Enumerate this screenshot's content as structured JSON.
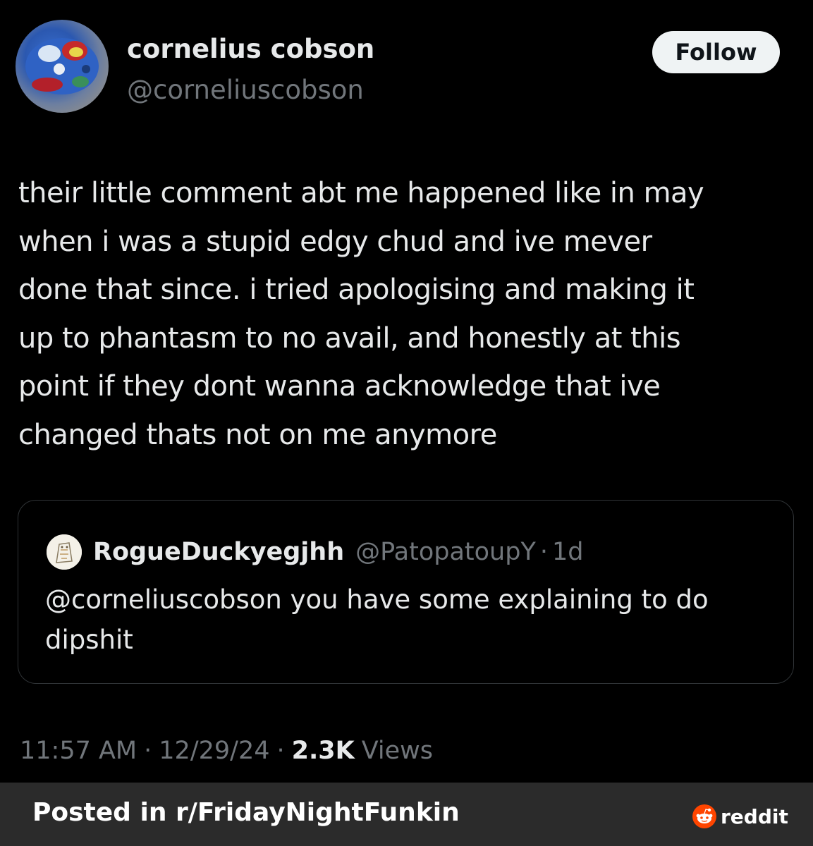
{
  "tweet": {
    "display_name": "cornelius cobson",
    "handle": "@corneliuscobson",
    "follow_label": "Follow",
    "body_lines": [
      "their little comment abt me happened like in may",
      "when i was a stupid edgy chud and ive mever",
      "done that since. i tried apologising and making it",
      "up to phantasm to no avail, and honestly at this",
      "point if they dont wanna acknowledge that ive",
      "changed thats not on me anymore"
    ],
    "quote": {
      "display_name": "RogueDuckyegjhh",
      "handle": "@PatopatoupY",
      "dot": "·",
      "time": "1d",
      "text_lines": [
        "@corneliuscobson you have some explaining to do",
        "dipshit"
      ]
    },
    "meta": {
      "time": "11:57 AM",
      "sep": "·",
      "date": "12/29/24",
      "views_count": "2.3K",
      "views_label": "Views"
    }
  },
  "footer": {
    "posted_in": "Posted in r/FridayNightFunkin",
    "brand": "reddit"
  },
  "colors": {
    "background": "#000000",
    "text_primary": "#e7e9ea",
    "text_secondary": "#71767b",
    "follow_bg": "#eff3f4",
    "footer_bg": "#2b2b2b",
    "reddit_orange": "#ff4500"
  },
  "icons": [
    "avatar-image",
    "quote-avatar-image",
    "reddit-logo-icon"
  ]
}
